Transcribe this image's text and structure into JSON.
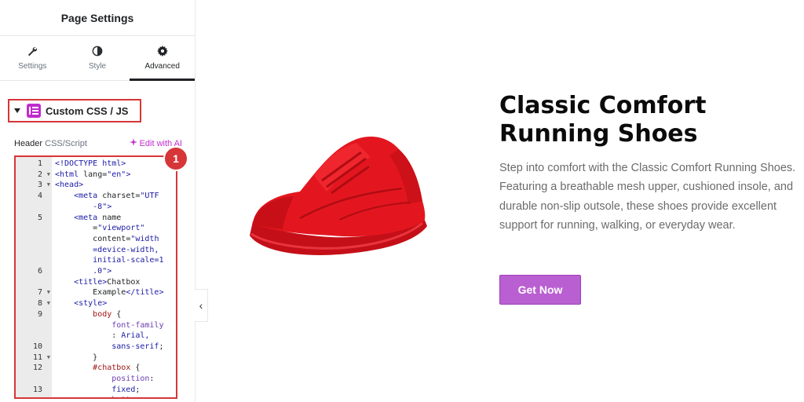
{
  "panel": {
    "title": "Page Settings",
    "tabs": [
      {
        "label": "Settings",
        "icon": "wrench-icon"
      },
      {
        "label": "Style",
        "icon": "half-circle-icon"
      },
      {
        "label": "Advanced",
        "icon": "gear-icon",
        "active": true
      }
    ],
    "section": {
      "label": "Custom CSS / JS",
      "icon": "elementor-badge-icon"
    },
    "field": {
      "label_bold": "Header",
      "label_rest": " CSS/Script",
      "ai_link": "Edit with AI"
    },
    "step_number": "1",
    "code_lines": [
      {
        "num": "1",
        "fold": false
      },
      {
        "num": "2",
        "fold": true
      },
      {
        "num": "3",
        "fold": true
      },
      {
        "num": "4",
        "fold": false
      },
      {
        "num": "",
        "fold": false
      },
      {
        "num": "5",
        "fold": false
      },
      {
        "num": "",
        "fold": false
      },
      {
        "num": "",
        "fold": false
      },
      {
        "num": "",
        "fold": false
      },
      {
        "num": "",
        "fold": false
      },
      {
        "num": "6",
        "fold": false
      },
      {
        "num": "",
        "fold": false
      },
      {
        "num": "7",
        "fold": true
      },
      {
        "num": "8",
        "fold": true
      },
      {
        "num": "9",
        "fold": false
      },
      {
        "num": "",
        "fold": false
      },
      {
        "num": "",
        "fold": false
      },
      {
        "num": "10",
        "fold": false
      },
      {
        "num": "11",
        "fold": true
      },
      {
        "num": "12",
        "fold": false
      },
      {
        "num": "",
        "fold": false
      },
      {
        "num": "13",
        "fold": false
      }
    ]
  },
  "product": {
    "title": "Classic Comfort Running Shoes",
    "description": "Step into comfort with the Classic Comfort Running Shoes. Featuring a breathable mesh upper, cushioned insole, and durable non-slip outsole, these shoes provide excellent support for running, walking, or everyday wear.",
    "button_label": "Get Now",
    "image": "red-running-shoe"
  },
  "colors": {
    "accent": "#b95fd1",
    "highlight": "#d63638",
    "elementor": "#c22bcf"
  }
}
